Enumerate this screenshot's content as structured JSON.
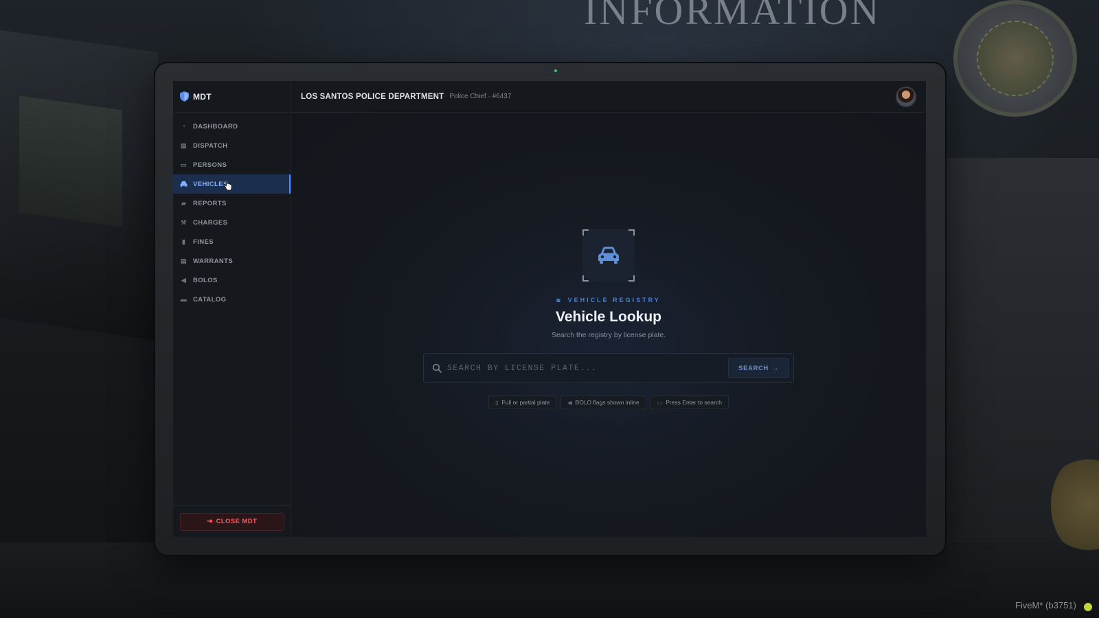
{
  "background": {
    "sign_text": "INFORMATION",
    "client_label": "FiveM* (b3751)"
  },
  "sidebar": {
    "brand": "MDT",
    "items": [
      {
        "label": "DASHBOARD",
        "icon": "dashboard-icon",
        "active": false
      },
      {
        "label": "DISPATCH",
        "icon": "dispatch-icon",
        "active": false
      },
      {
        "label": "PERSONS",
        "icon": "id-card-icon",
        "active": false
      },
      {
        "label": "VEHICLES",
        "icon": "car-icon",
        "active": true
      },
      {
        "label": "REPORTS",
        "icon": "folder-icon",
        "active": false
      },
      {
        "label": "CHARGES",
        "icon": "gavel-icon",
        "active": false
      },
      {
        "label": "FINES",
        "icon": "receipt-icon",
        "active": false
      },
      {
        "label": "WARRANTS",
        "icon": "warrant-icon",
        "active": false
      },
      {
        "label": "BOLOS",
        "icon": "megaphone-icon",
        "active": false
      },
      {
        "label": "CATALOG",
        "icon": "catalog-icon",
        "active": false
      }
    ],
    "close_label": "CLOSE MDT"
  },
  "header": {
    "department": "LOS SANTOS POLICE DEPARTMENT",
    "rank": "Police Chief · #6437"
  },
  "lookup": {
    "eyebrow": "VEHICLE REGISTRY",
    "title": "Vehicle Lookup",
    "subtitle": "Search the registry by license plate.",
    "search_placeholder": "SEARCH BY LICENSE PLATE...",
    "search_value": "",
    "search_button": "SEARCH",
    "chips": [
      {
        "label": "Full or partial plate",
        "icon": "document-icon"
      },
      {
        "label": "BOLO flags shown inline",
        "icon": "megaphone-icon"
      },
      {
        "label": "Press Enter to search",
        "icon": "keyboard-icon"
      }
    ]
  },
  "colors": {
    "accent": "#4f8dff",
    "danger": "#ff5a5f",
    "background": "#14171c"
  }
}
